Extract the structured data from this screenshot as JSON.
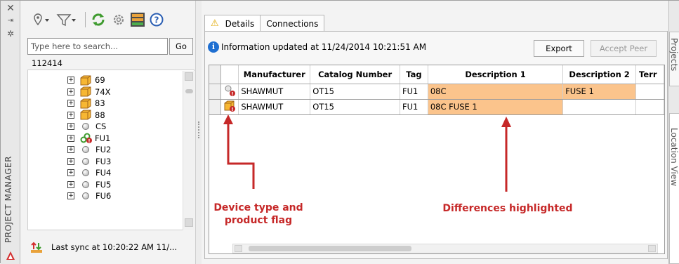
{
  "left_strip": {
    "title": "PROJECT MANAGER",
    "icons": [
      "close-icon",
      "pin-icon",
      "settings-icon",
      "autodesk-logo-icon"
    ]
  },
  "toolbar": {
    "icons": [
      "location-marker-icon",
      "filter-icon",
      "refresh-icon",
      "gear-icon",
      "panel-layout-icon",
      "help-icon"
    ]
  },
  "search": {
    "placeholder": "Type here to search...",
    "go_label": "Go"
  },
  "project": {
    "name": "112414"
  },
  "tree": {
    "items": [
      {
        "label": "69",
        "icon": "device-box-icon"
      },
      {
        "label": "74X",
        "icon": "device-box-icon"
      },
      {
        "label": "83",
        "icon": "device-box-icon"
      },
      {
        "label": "88",
        "icon": "device-box-icon"
      },
      {
        "label": "CS",
        "icon": "circle-icon"
      },
      {
        "label": "FU1",
        "icon": "linked-flag-icon"
      },
      {
        "label": "FU2",
        "icon": "circle-icon"
      },
      {
        "label": "FU3",
        "icon": "circle-icon"
      },
      {
        "label": "FU4",
        "icon": "circle-icon"
      },
      {
        "label": "FU5",
        "icon": "circle-icon"
      },
      {
        "label": "FU6",
        "icon": "circle-icon"
      }
    ]
  },
  "sync": {
    "text": "Last sync at 10:20:22 AM 11/..."
  },
  "tabs": [
    {
      "label": "Details",
      "active": true
    },
    {
      "label": "Connections",
      "active": false
    }
  ],
  "info": {
    "text": "Information updated at  11/24/2014 10:21:51 AM"
  },
  "buttons": {
    "export": "Export",
    "accept_peer": "Accept Peer"
  },
  "grid": {
    "columns": [
      "Manufacturer",
      "Catalog Number",
      "Tag",
      "Description 1",
      "Description 2",
      "Terr"
    ],
    "rows": [
      {
        "manufacturer": "SHAWMUT",
        "catalog": "OT15",
        "tag": "FU1",
        "desc1": "08C",
        "desc2": "FUSE 1",
        "flag": "search-flag-icon"
      },
      {
        "manufacturer": "SHAWMUT",
        "catalog": "OT15",
        "tag": "FU1",
        "desc1": "08C FUSE 1",
        "desc2": "",
        "flag": "device-flag-icon"
      }
    ],
    "highlight_color": "#fbc48c"
  },
  "annotations": {
    "left": "Device type and\nproduct flag",
    "right": "Differences highlighted",
    "color": "#c62828"
  },
  "right_tabs": [
    "Projects",
    "Location View"
  ]
}
